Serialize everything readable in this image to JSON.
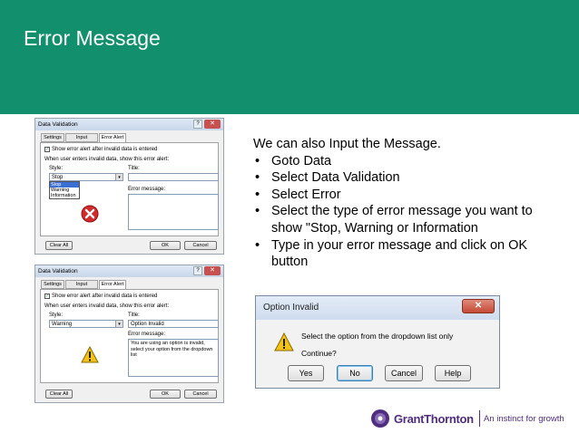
{
  "header": {
    "title": "Error Message"
  },
  "dialog1": {
    "title": "Data Validation",
    "tabs": [
      "Settings",
      "Input Message",
      "Error Alert"
    ],
    "show_alert_label": "Show error alert after invalid data is entered",
    "when_label": "When user enters invalid data, show this error alert:",
    "style_label": "Style:",
    "style_value": "Stop",
    "style_options": [
      "Stop",
      "Warning",
      "Information"
    ],
    "title_label": "Title:",
    "title_value": "",
    "error_message_label": "Error message:",
    "error_message_value": "",
    "clear_all": "Clear All",
    "ok": "OK",
    "cancel": "Cancel"
  },
  "dialog2": {
    "title": "Data Validation",
    "tabs": [
      "Settings",
      "Input Message",
      "Error Alert"
    ],
    "show_alert_label": "Show error alert after invalid data is entered",
    "when_label": "When user enters invalid data, show this error alert:",
    "style_label": "Style:",
    "style_value": "Warning",
    "title_label": "Title:",
    "title_value": "Option Invalid",
    "error_message_label": "Error message:",
    "error_message_value": "You are using an option is invalid, select your option from the dropdown list",
    "clear_all": "Clear All",
    "ok": "OK",
    "cancel": "Cancel"
  },
  "instructions": {
    "intro": "We can also Input the Message.",
    "steps": [
      "Goto Data",
      "Select Data Validation",
      "Select Error",
      "Select the type of error message you want to show \"Stop, Warning or Information",
      "Type in your error message and click on OK button"
    ]
  },
  "alert": {
    "title": "Option Invalid",
    "message": "Select the option from the dropdown list only",
    "continue": "Continue?",
    "buttons": [
      "Yes",
      "No",
      "Cancel",
      "Help"
    ]
  },
  "logo": {
    "brand": "GrantThornton",
    "tagline": "An instinct for growth"
  },
  "colors": {
    "header_bg": "#12906d",
    "brand_purple": "#4f2d7f"
  }
}
